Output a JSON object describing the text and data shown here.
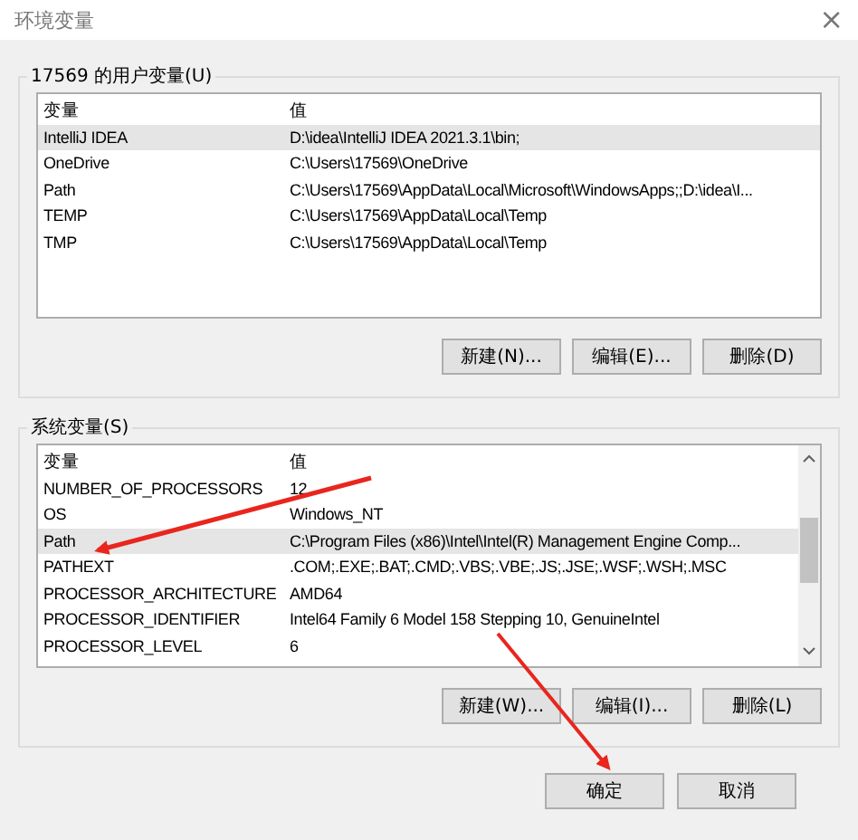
{
  "window": {
    "title": "环境变量",
    "close": "×"
  },
  "user_vars": {
    "label": "17569 的用户变量(U)",
    "columns": [
      "变量",
      "值"
    ],
    "rows": [
      {
        "name": "IntelliJ IDEA",
        "value": "D:\\idea\\IntelliJ IDEA 2021.3.1\\bin;",
        "selected": true
      },
      {
        "name": "OneDrive",
        "value": "C:\\Users\\17569\\OneDrive",
        "selected": false
      },
      {
        "name": "Path",
        "value": "C:\\Users\\17569\\AppData\\Local\\Microsoft\\WindowsApps;;D:\\idea\\I...",
        "selected": false
      },
      {
        "name": "TEMP",
        "value": "C:\\Users\\17569\\AppData\\Local\\Temp",
        "selected": false
      },
      {
        "name": "TMP",
        "value": "C:\\Users\\17569\\AppData\\Local\\Temp",
        "selected": false
      }
    ],
    "buttons": [
      "新建(N)...",
      "编辑(E)...",
      "删除(D)"
    ]
  },
  "system_vars": {
    "label": "系统变量(S)",
    "columns": [
      "变量",
      "值"
    ],
    "rows": [
      {
        "name": "NUMBER_OF_PROCESSORS",
        "value": "12",
        "selected": false
      },
      {
        "name": "OS",
        "value": "Windows_NT",
        "selected": false
      },
      {
        "name": "Path",
        "value": "C:\\Program Files (x86)\\Intel\\Intel(R) Management Engine Comp...",
        "selected": true
      },
      {
        "name": "PATHEXT",
        "value": ".COM;.EXE;.BAT;.CMD;.VBS;.VBE;.JS;.JSE;.WSF;.WSH;.MSC",
        "selected": false
      },
      {
        "name": "PROCESSOR_ARCHITECTURE",
        "value": "AMD64",
        "selected": false
      },
      {
        "name": "PROCESSOR_IDENTIFIER",
        "value": "Intel64 Family 6 Model 158 Stepping 10, GenuineIntel",
        "selected": false
      },
      {
        "name": "PROCESSOR_LEVEL",
        "value": "6",
        "selected": false
      }
    ],
    "buttons": [
      "新建(W)...",
      "编辑(I)...",
      "删除(L)"
    ]
  },
  "footer_buttons": [
    "确定",
    "取消"
  ]
}
